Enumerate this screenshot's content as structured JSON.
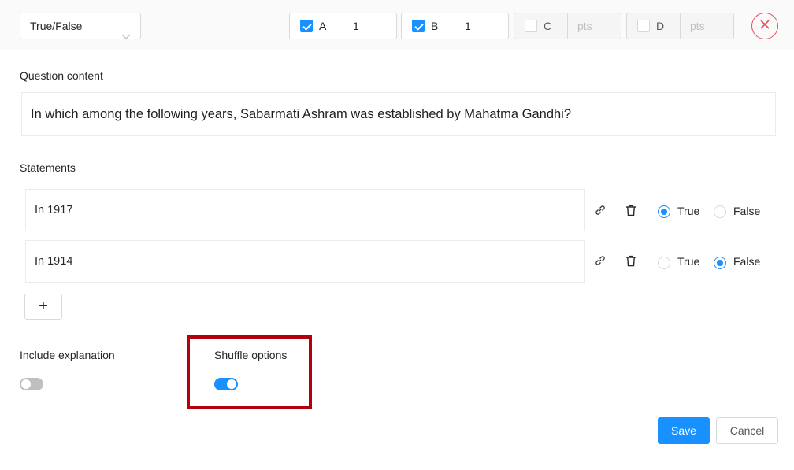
{
  "toolbar": {
    "question_type": "True/False",
    "options": [
      {
        "letter": "A",
        "checked": true,
        "points": "1"
      },
      {
        "letter": "B",
        "checked": true,
        "points": "1"
      },
      {
        "letter": "C",
        "checked": false,
        "points_placeholder": "pts"
      },
      {
        "letter": "D",
        "checked": false,
        "points_placeholder": "pts"
      }
    ],
    "close_icon": "close-x-icon",
    "close_color": "#e0525b"
  },
  "question": {
    "label": "Question content",
    "text": "In which among the following years, Sabarmati Ashram was established by Mahatma Gandhi?"
  },
  "statements": {
    "label": "Statements",
    "items": [
      {
        "text": "In 1917",
        "answer": "True",
        "true_label": "True",
        "false_label": "False"
      },
      {
        "text": "In 1914",
        "answer": "False",
        "true_label": "True",
        "false_label": "False"
      }
    ],
    "add_label": "+"
  },
  "settings": {
    "include_explanation": {
      "label": "Include explanation",
      "enabled": false
    },
    "shuffle_options": {
      "label": "Shuffle options",
      "enabled": true
    }
  },
  "actions": {
    "save_label": "Save",
    "cancel_label": "Cancel"
  },
  "colors": {
    "accent": "#1890ff",
    "highlight": "#b3000d"
  }
}
